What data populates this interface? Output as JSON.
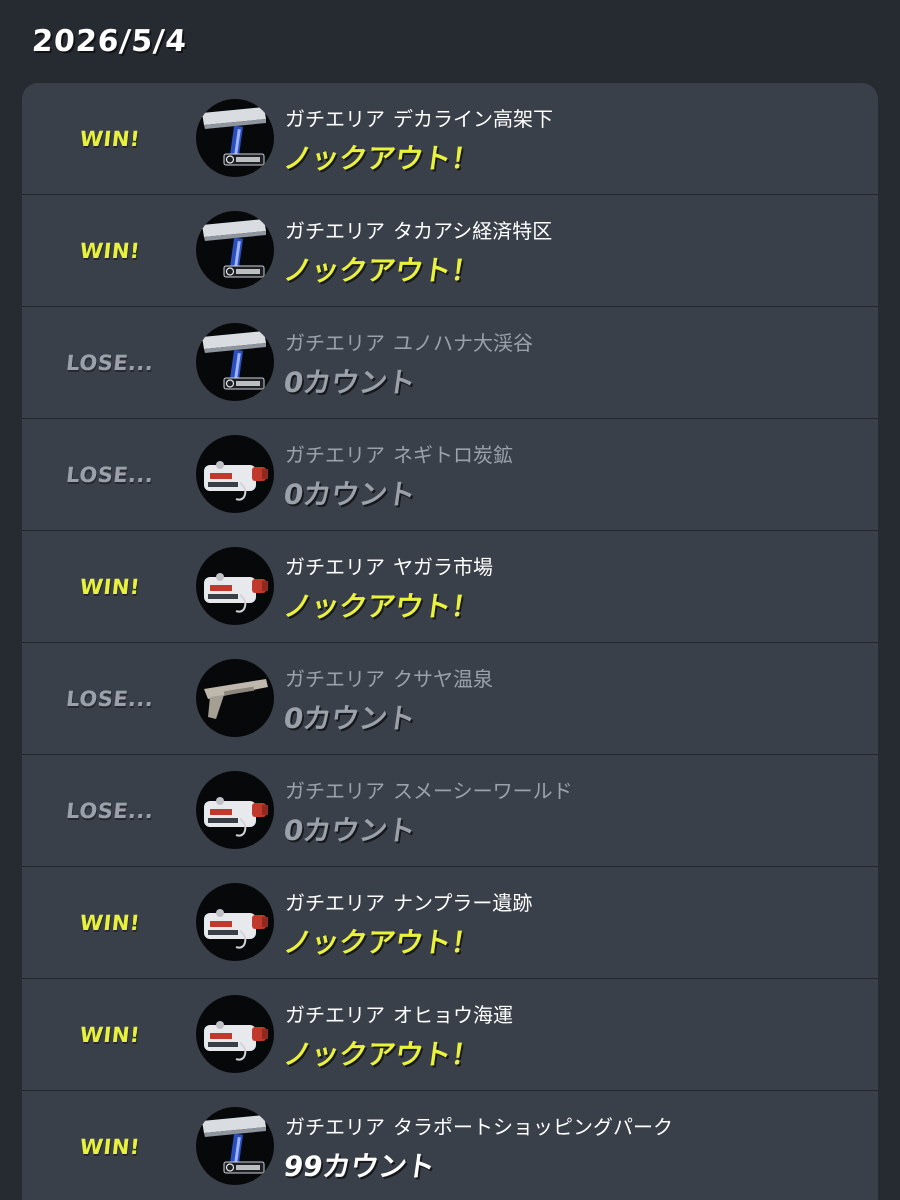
{
  "date": "2026/5/4",
  "colors": {
    "background": "#262a31",
    "card": "#3a4049",
    "win": "#e8f23a",
    "lose": "#9ba1aa",
    "knockout": "#eaf23c"
  },
  "battles": [
    {
      "result": "win",
      "result_label": "WIN!",
      "mode": "ガチエリア",
      "stage": "デカライン高架下",
      "count_label": "ノックアウト！",
      "count_style": "knockout",
      "weapon_icon": "roller-icon"
    },
    {
      "result": "win",
      "result_label": "WIN!",
      "mode": "ガチエリア",
      "stage": "タカアシ経済特区",
      "count_label": "ノックアウト！",
      "count_style": "knockout",
      "weapon_icon": "roller-icon"
    },
    {
      "result": "lose",
      "result_label": "LOSE...",
      "mode": "ガチエリア",
      "stage": "ユノハナ大渓谷",
      "count_label": "0カウント",
      "count_style": "zero",
      "weapon_icon": "roller-icon"
    },
    {
      "result": "lose",
      "result_label": "LOSE...",
      "mode": "ガチエリア",
      "stage": "ネギトロ炭鉱",
      "count_label": "0カウント",
      "count_style": "zero",
      "weapon_icon": "blaster-icon"
    },
    {
      "result": "win",
      "result_label": "WIN!",
      "mode": "ガチエリア",
      "stage": "ヤガラ市場",
      "count_label": "ノックアウト！",
      "count_style": "knockout",
      "weapon_icon": "blaster-icon"
    },
    {
      "result": "lose",
      "result_label": "LOSE...",
      "mode": "ガチエリア",
      "stage": "クサヤ温泉",
      "count_label": "0カウント",
      "count_style": "zero",
      "weapon_icon": "shooter-icon"
    },
    {
      "result": "lose",
      "result_label": "LOSE...",
      "mode": "ガチエリア",
      "stage": "スメーシーワールド",
      "count_label": "0カウント",
      "count_style": "zero",
      "weapon_icon": "blaster-icon"
    },
    {
      "result": "win",
      "result_label": "WIN!",
      "mode": "ガチエリア",
      "stage": "ナンプラー遺跡",
      "count_label": "ノックアウト！",
      "count_style": "knockout",
      "weapon_icon": "blaster-icon"
    },
    {
      "result": "win",
      "result_label": "WIN!",
      "mode": "ガチエリア",
      "stage": "オヒョウ海運",
      "count_label": "ノックアウト！",
      "count_style": "knockout",
      "weapon_icon": "blaster-icon"
    },
    {
      "result": "win",
      "result_label": "WIN!",
      "mode": "ガチエリア",
      "stage": "タラポートショッピングパーク",
      "count_label": "99カウント",
      "count_style": "normal",
      "weapon_icon": "roller-icon"
    }
  ]
}
